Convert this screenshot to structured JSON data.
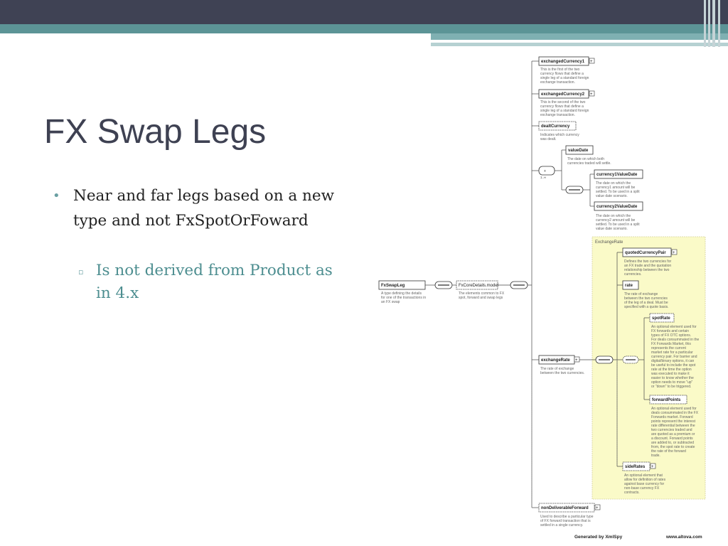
{
  "slide": {
    "title": "FX Swap Legs",
    "bullet1": "Near and far legs based on a new type and not FxSpotOrFoward",
    "sub1": "Is not derived from Product as in 4.x"
  },
  "diagram": {
    "root": {
      "name": "FxSwapLeg",
      "desc": [
        "A type defining the details",
        "for one of the transactions in",
        "an FX swap"
      ]
    },
    "model": {
      "name": "FxCoreDetails.model",
      "desc": [
        "The elements common to FX",
        "spot, forward and swap legs"
      ]
    },
    "exchangedCurrency1": {
      "name": "exchangedCurrency1",
      "desc": [
        "This is the first of the two",
        "currency flows that define a",
        "single leg of a standard foreign",
        "exchange transaction."
      ]
    },
    "exchangedCurrency2": {
      "name": "exchangedCurrency2",
      "desc": [
        "This is the second of the two",
        "currency flows that define a",
        "single leg of a standard foreign",
        "exchange transaction."
      ]
    },
    "dealtCurrency": {
      "name": "dealtCurrency",
      "desc": [
        "Indicates which currency",
        "was dealt."
      ]
    },
    "valueDate": {
      "name": "valueDate",
      "desc": [
        "The date on which both",
        "currencies traded will settle."
      ]
    },
    "currency1ValueDate": {
      "name": "currency1ValueDate",
      "desc": [
        "The date on which the",
        "currency1 amount will be",
        "settled. To be used in a split",
        "value date scenario."
      ]
    },
    "currency2ValueDate": {
      "name": "currency2ValueDate",
      "desc": [
        "The date on which the",
        "currency2 amount will be",
        "settled. To be used in a split",
        "value date scenario."
      ]
    },
    "exchangeRateType": {
      "label": "ExchangeRate"
    },
    "quotedCurrencyPair": {
      "name": "quotedCurrencyPair",
      "desc": [
        "Defines the two currencies for",
        "an FX trade and the quotation",
        "relationship between the two",
        "currencies."
      ]
    },
    "rate": {
      "name": "rate",
      "desc": [
        "The rate of exchange",
        "between the two currencies",
        "of the leg of a deal. Must be",
        "specified with a quote basis."
      ]
    },
    "spotRate": {
      "name": "spotRate",
      "desc": [
        "An optional element used for",
        "FX forwards and certain",
        "types of FX OTC options.",
        "For deals consummated in the",
        "FX Forwards Market, this",
        "represents the current",
        "market rate for a particular",
        "currency pair. For barrier and",
        "digital/binary options, it can",
        "be useful to include the spot",
        "rate at the time the option",
        "was executed to make it",
        "easier to know whether the",
        "option needs to move \"up\"",
        "or \"down\" to be triggered."
      ]
    },
    "forwardPoints": {
      "name": "forwardPoints",
      "desc": [
        "An optional element used for",
        "deals consummated in the FX",
        "Forwards market. Forward",
        "points represent the interest",
        "rate differential between the",
        "two currencies traded and",
        "are quoted as a premium or",
        "a discount. Forward points",
        "are added to, or subtracted",
        "from, the spot rate to create",
        "the rate of the forward",
        "trade."
      ]
    },
    "sideRates": {
      "name": "sideRates",
      "desc": [
        "An optional element that",
        "allow for definition of rates",
        "against base currency for",
        "non-base currency FX",
        "contracts."
      ]
    },
    "exchangeRate": {
      "name": "exchangeRate",
      "desc": [
        "The rate of exchange",
        "between the two currencies."
      ]
    },
    "nonDeliverableForward": {
      "name": "nonDeliverableForward",
      "desc": [
        "Used to describe a particular type",
        "of FX forward transaction that is",
        "settled in a single currency."
      ]
    },
    "choiceLabel": "1..∞",
    "footer": {
      "generated": "Generated by XmlSpy",
      "site": "www.altova.com"
    }
  },
  "colors": {
    "accent": "#5c9496",
    "topbar": "#3f4254",
    "title": "#3e4152",
    "subtext": "#4d8e90",
    "typebox": "#fafac8"
  }
}
